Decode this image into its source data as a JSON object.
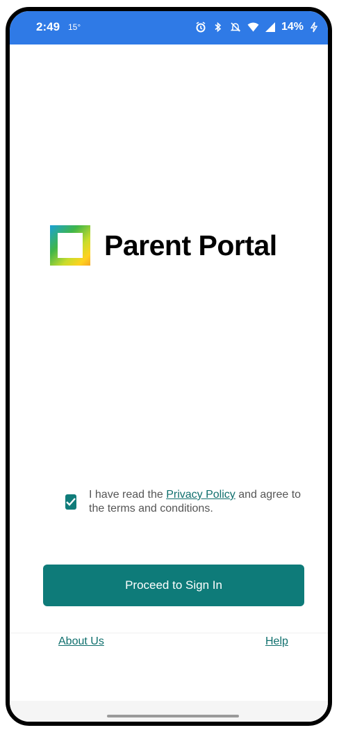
{
  "status_bar": {
    "time": "2:49",
    "temperature": "15°",
    "battery_percent": "14%",
    "icons": [
      "alarm-icon",
      "bluetooth-icon",
      "mute-icon",
      "wifi-icon",
      "signal-icon",
      "charging-icon"
    ]
  },
  "logo": {
    "text": "Parent Portal",
    "colors": [
      "#1aa0d8",
      "#3fb54a",
      "#c9dc2b",
      "#ffd21f",
      "#f5a623"
    ]
  },
  "consent": {
    "checked": true,
    "text_before": "I have read the ",
    "link_text": "Privacy Policy",
    "text_after": " and agree to the terms and conditions."
  },
  "proceed_button": {
    "label": "Proceed to Sign In"
  },
  "footer": {
    "about_label": "About Us",
    "help_label": "Help"
  },
  "colors": {
    "accent": "#0e7b79",
    "status_bar": "#2f7ae6"
  }
}
